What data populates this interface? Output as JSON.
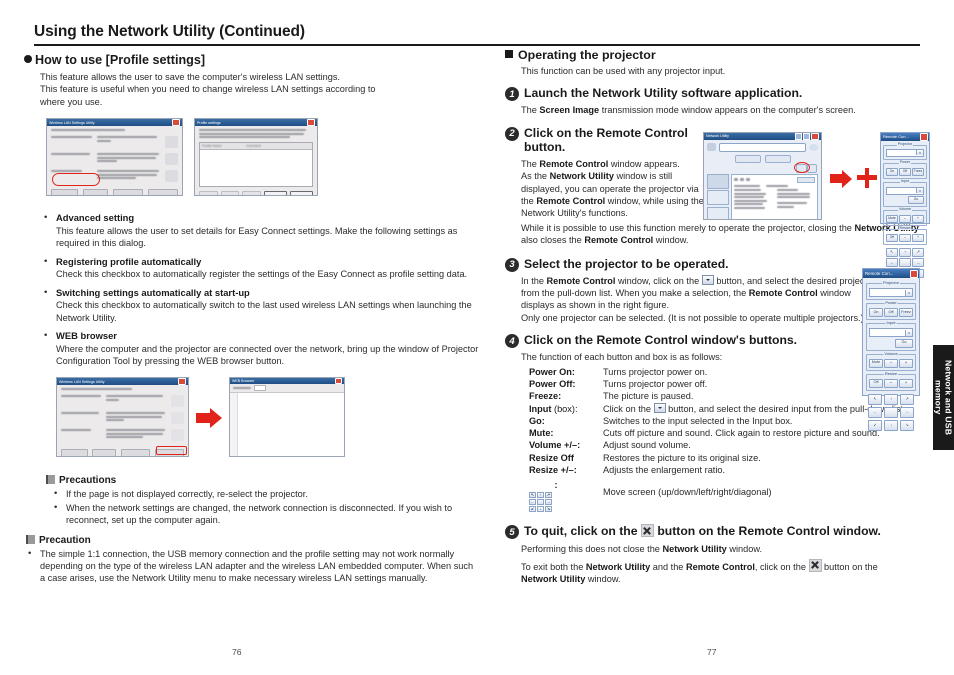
{
  "header": {
    "title": "Using the Network Utility (Continued)"
  },
  "side_tab": {
    "label": "Network and USB memory"
  },
  "page_numbers": {
    "left": "76",
    "right": "77"
  },
  "left": {
    "section_title": "How to use [Profile settings]",
    "intro_line1": "This feature allows the user to save the computer's wireless LAN settings.",
    "intro_line2": "This feature is useful when you need to change wireless LAN settings according to",
    "intro_line3": "where you use.",
    "bullets": [
      {
        "title": "Advanced setting",
        "body": "This feature allows the user to set details for Easy Connect settings. Make the following settings as required in this dialog."
      },
      {
        "title": "Registering profile automatically",
        "body": "Check this checkbox to automatically register the settings of the Easy Connect as profile setting data."
      },
      {
        "title": "Switching settings automatically at start-up",
        "body": "Check this checkbox to automatically switch to the last used wireless LAN settings when launching the Network Utility."
      },
      {
        "title": "WEB browser",
        "body": "Where the computer and the projector are connected over the network, bring up the window of Projector Configuration Tool by pressing the WEB browser button."
      }
    ],
    "precautions": {
      "heading": "Precautions",
      "items": [
        "If the page is not displayed correctly, re-select the projector.",
        "When the network settings are changed, the network connection is disconnected. If you wish to reconnect, set up the computer again."
      ]
    },
    "precaution": {
      "heading": "Precaution",
      "items": [
        "The simple 1:1 connection, the USB memory connection and the profile setting may not work normally depending on the type of the wireless LAN adapter and the wireless LAN embedded computer. When such a case arises, use the Network Utility menu to make necessary wireless LAN settings manually."
      ]
    },
    "figures": {
      "wireless_utility_title": "Wireless LAN Settings Utility",
      "wireless_utility_sub": "Select the method you want (3/3.)",
      "profile_settings_title": "Profile settings",
      "profile_settings_sub": "Please select the settings information and press the desired button. When [restart] is pressed, the settings of the PC is be currently being used are changed to the selected setting information.",
      "profile_col_name": "Profile Name",
      "profile_col_comment": "Comment",
      "profile_btn_start": "Start",
      "profile_btn_stop": "Stop",
      "web_browser_title": "WEB Browser"
    }
  },
  "right": {
    "section_title": "Operating the projector",
    "section_intro": "This function can be used with any projector input.",
    "steps": [
      {
        "num": "1",
        "title": "Launch the Network Utility software application.",
        "paras": [
          "The <b>Screen Image</b> transmission mode window appears on the computer's screen."
        ]
      },
      {
        "num": "2",
        "title": "Click on the Remote Control button.",
        "paras": [
          "The <b>Remote Control</b> window appears.",
          "As the <b>Network Utility</b> window is still displayed, you can operate the projector via the <b>Remote Control</b> window, while using the Network Utility's functions.",
          "While it is possible to use this function merely to operate the projector, closing the <b>Network Utility</b> also closes the <b>Remote Control</b> window."
        ]
      },
      {
        "num": "3",
        "title": "Select the projector to be operated.",
        "paras": [
          "In the <b>Remote Control</b> window, click on the [CARET] button, and select the desired projector from the pull-down list. When you make a selection, the <b>Remote Control</b> window displays as shown in  the right figure.",
          "Only one projector can be selected. (It is not possible to operate multiple projectors.)"
        ]
      },
      {
        "num": "4",
        "title": "Click on the Remote Control window's buttons.",
        "paras": [
          "The function of each button and box is as follows:"
        ]
      },
      {
        "num": "5",
        "title_pre": "To quit, click on the",
        "title_post": "button on the Remote Control window.",
        "paras": [
          "Performing this does not close the <b>Network Utility</b> window.",
          "To exit both the <b>Network Utility</b> and the <b>Remote Control</b>, click on the [X] button on the <b>Network Utility</b> window."
        ]
      }
    ],
    "function_table": [
      {
        "key": "Power On:",
        "value": "Turns projector power on."
      },
      {
        "key": "Power Off:",
        "value": "Turns projector power off."
      },
      {
        "key": "Freeze:",
        "value": "The picture is paused."
      },
      {
        "key": "Input",
        "key_suffix": " (box):",
        "value": "Click on the [CARET] button, and select the desired input from the pull-down list."
      },
      {
        "key": "Go:",
        "value": "Switches to the input selected in the Input box."
      },
      {
        "key": "Mute:",
        "value": "Cuts off picture and sound. Click again to restore picture and sound."
      },
      {
        "key": "Volume +/–:",
        "value": "Adjust sound volume."
      },
      {
        "key": "Resize Off",
        "value": "Restores the picture to its original size."
      },
      {
        "key": "Resize +/–:",
        "value": "Adjusts the enlargement ratio."
      },
      {
        "key": "[PAD] :",
        "value": "Move screen (up/down/left/right/diagonal)"
      }
    ],
    "figures": {
      "network_utility_title": "Network Utility",
      "remote_control_title": "Remote Con...",
      "rc_group_projector": "Projector",
      "rc_group_power": "Power",
      "rc_group_input": "Input",
      "rc_group_volume": "Volume",
      "rc_group_resize": "Resize",
      "rc_power_on": "On",
      "rc_power_off": "Off",
      "rc_power_freeze": "Freez",
      "rc_go": "Go",
      "rc_mute": "Mute",
      "rc_minus": "–",
      "rc_plus": "+",
      "rc_resize_off": "Off",
      "rc_pad": [
        "↖",
        "↑",
        "↗",
        "←",
        "→",
        "↙",
        "↓",
        "↘"
      ]
    }
  },
  "colors": {
    "accent_red": "#e2231a",
    "ink": "#1a1a1a",
    "titlebar_blue": "#1f4e85"
  }
}
